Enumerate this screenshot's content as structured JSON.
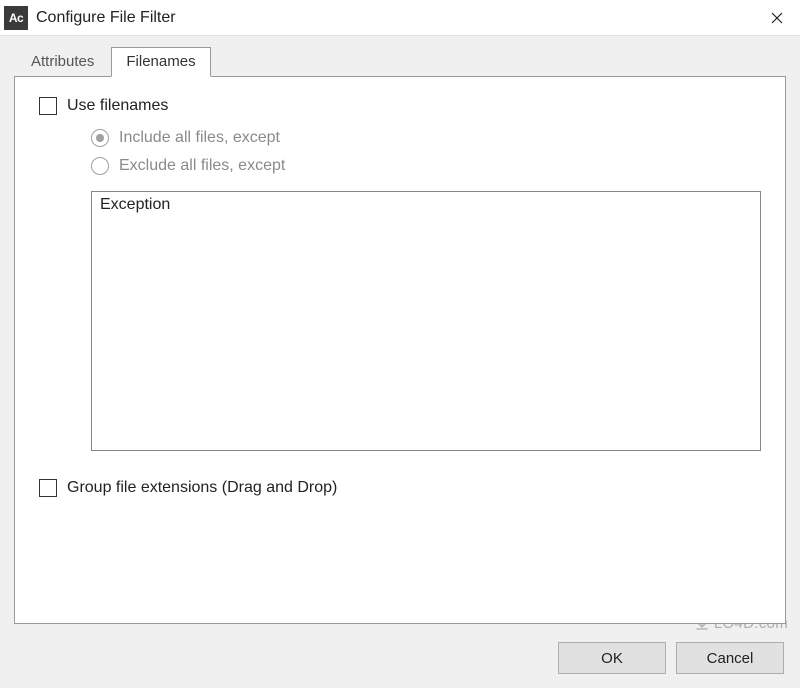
{
  "window": {
    "app_icon_text": "Ac",
    "title": "Configure File Filter"
  },
  "tabs": {
    "attributes": "Attributes",
    "filenames": "Filenames"
  },
  "filenames_panel": {
    "use_filenames_label": "Use filenames",
    "include_label": "Include all files, except",
    "exclude_label": "Exclude all files, except",
    "list_header": "Exception",
    "group_extensions_label": "Group file extensions (Drag and Drop)"
  },
  "buttons": {
    "ok": "OK",
    "cancel": "Cancel"
  },
  "watermark": {
    "text": "LO4D.com"
  }
}
